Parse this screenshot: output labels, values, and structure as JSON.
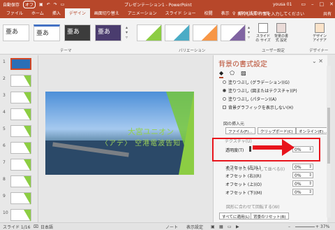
{
  "titlebar": {
    "autosave": "自動保存",
    "autosave_state": "オフ",
    "title": "プレゼンテーション1 - PowerPoint",
    "user": "yousa 01",
    "min_icon": "minimize-icon",
    "max_icon": "maximize-icon",
    "close_icon": "close-icon"
  },
  "tabs": [
    "ファイル",
    "ホーム",
    "挿入",
    "デザイン",
    "画面切り替え",
    "アニメーション",
    "スライド ショー",
    "校閲",
    "表示",
    "ATOK拡張ツール"
  ],
  "active_tab": "デザイン",
  "tellme": "実行したい作業を入力してください",
  "share": "共有",
  "ribbon": {
    "themes_label": "テーマ",
    "variants_label": "バリエーション",
    "user_settings_label": "ユーザー設定",
    "designer_label": "デザイナー",
    "theme_samples": [
      "亜あ",
      "亜あ",
      "亜あ",
      "亜あ"
    ],
    "btn_slide_size": "スライドの サイズ",
    "btn_bg_format": "背景の書式 設定",
    "btn_design_ideas": "デザイン アイデア"
  },
  "slides": {
    "numbers": [
      "1",
      "2",
      "3",
      "4",
      "5",
      "6",
      "7",
      "8",
      "9",
      "10"
    ]
  },
  "slide": {
    "title": "大宮ユニオン",
    "subtitle": "〈アデ〉 空港電波告知"
  },
  "pane": {
    "title": "背景の書式設定",
    "fill_options": [
      "塗りつぶし (グラデーション)(G)",
      "塗りつぶし (図またはテクスチャ)(P)",
      "塗りつぶし (パターン)(A)"
    ],
    "hide_graphics": "背景グラフィックを表示しない(H)",
    "insert_from": "図の挿入元",
    "btn_file": "ファイル(F)...",
    "btn_clipboard": "クリップボード(C)",
    "btn_online": "オンライン(E)...",
    "texture": "テクスチャ(U)",
    "transparency_label": "透明度(T)",
    "transparency_value": "0%",
    "tile": "図をテクスチャとして並べる(I)",
    "offset_left": "オフセット (左)(L)",
    "offset_right": "オフセット (右)(R)",
    "offset_top": "オフセット (上)(O)",
    "offset_bottom": "オフセット (下)(M)",
    "offset_values": [
      "0%",
      "0%",
      "0%",
      "0%"
    ],
    "rotate_with_shape": "図形に合わせて回転する(W)",
    "btn_apply_all": "すべてに適用(L)",
    "btn_reset": "背景のリセット(B)",
    "tab_icons": [
      "fill-bucket-icon",
      "pentagon-icon",
      "picture-icon"
    ]
  },
  "status": {
    "slide_info": "スライド 1/16",
    "language": "日本語",
    "notes": "ノート",
    "display_settings": "表示設定",
    "zoom": "37%"
  }
}
